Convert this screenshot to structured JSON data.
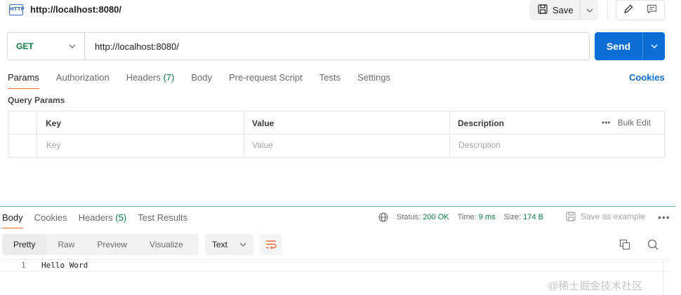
{
  "header": {
    "icon_text": "HTTP",
    "title": "http://localhost:8080/",
    "save_label": "Save"
  },
  "request": {
    "method": "GET",
    "url": "http://localhost:8080/",
    "send_label": "Send"
  },
  "tabs": {
    "params": "Params",
    "authorization": "Authorization",
    "headers": "Headers",
    "headers_count": "(7)",
    "body": "Body",
    "prerequest": "Pre-request Script",
    "tests": "Tests",
    "settings": "Settings",
    "cookies": "Cookies"
  },
  "query_params": {
    "section_label": "Query Params",
    "columns": {
      "key": "Key",
      "value": "Value",
      "description": "Description"
    },
    "placeholders": {
      "key": "Key",
      "value": "Value",
      "description": "Description"
    },
    "bulk_edit": "Bulk Edit",
    "more": "•••"
  },
  "response": {
    "tabs": {
      "body": "Body",
      "cookies": "Cookies",
      "headers": "Headers",
      "headers_count": "(5)",
      "test_results": "Test Results"
    },
    "status_label": "Status:",
    "status_value": "200 OK",
    "time_label": "Time:",
    "time_value": "9 ms",
    "size_label": "Size:",
    "size_value": "174 B",
    "save_as_example": "Save as example",
    "more": "•••",
    "view_tabs": {
      "pretty": "Pretty",
      "raw": "Raw",
      "preview": "Preview",
      "visualize": "Visualize"
    },
    "format": "Text",
    "code_line_number": "1",
    "code_text": "Hello Word"
  },
  "watermark": "@稀土掘金技术社区",
  "colors": {
    "accent_blue": "#0a6ed6",
    "method_green": "#0b7a3e",
    "tab_underline": "#f26b3a"
  }
}
